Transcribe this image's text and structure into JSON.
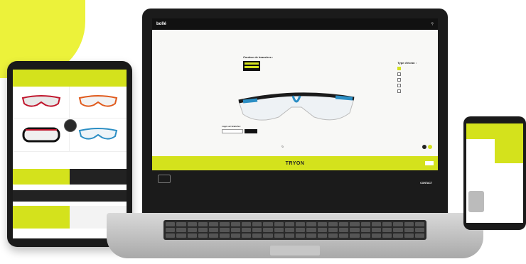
{
  "colors": {
    "accent": "#d4e21c",
    "dark": "#1b1b1b",
    "lens_blue": "#2b8ec4"
  },
  "tablet": {
    "banner": "",
    "products": [
      "",
      "",
      "",
      ""
    ],
    "center_badge": "",
    "bar_left": "",
    "bar_right": "",
    "mid_text": "",
    "bottom_left": "",
    "bottom_right": ""
  },
  "laptop": {
    "logo": "bollé",
    "nav": [
      "",
      "",
      "",
      "",
      "",
      ""
    ],
    "frame_color_title": "Couleur de branches :",
    "frame_color_label": "",
    "lens_title": "Type d'écran :",
    "lens_options": [
      "",
      "",
      "",
      "",
      ""
    ],
    "logo_title": "Logo sur branche :",
    "logo_placeholder": "",
    "logo_button": "",
    "back_label": "",
    "model_name": "TRYON",
    "next_label": "",
    "footer_text": "",
    "contact_title": "CONTACT",
    "contact_phone": "",
    "footer_links": ""
  },
  "phone": {
    "top_text": "",
    "row1_left": "",
    "row1_right": "",
    "promo_text": "",
    "logos": [
      "",
      "",
      "",
      ""
    ]
  }
}
